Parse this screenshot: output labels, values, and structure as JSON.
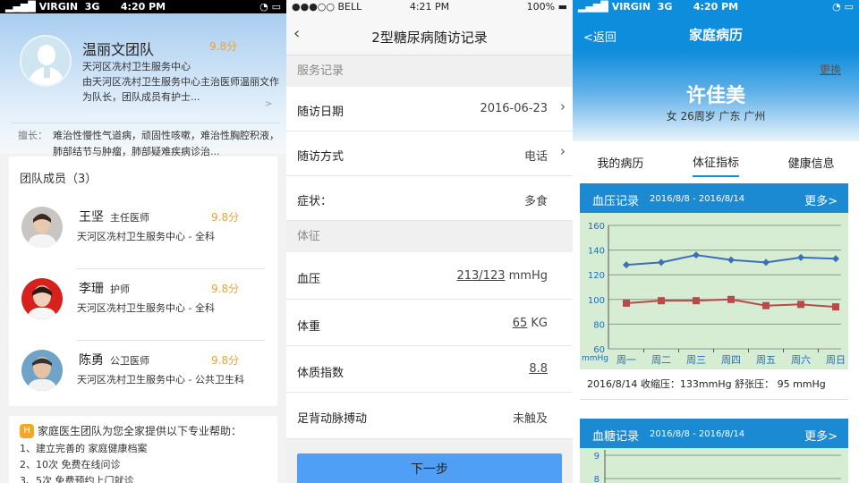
{
  "colors": {
    "accent": "#0d8ddb",
    "score": "#f0a034",
    "button": "#4f9ff7",
    "systolic": "#3b6fb8",
    "diastolic": "#b94a48",
    "chart_bg": "#d6ecd3"
  },
  "screen1": {
    "status": {
      "carrier": "VIRGIN",
      "network": "3G",
      "time": "4:20 PM"
    },
    "team_name": "温丽文团队",
    "score": "9.8分",
    "org": "天河区冼村卫生服务中心",
    "description": "由天河区冼村卫生服务中心主治医师温丽文作为队长，团队成员有护士...",
    "specialty_label": "擅长：",
    "specialty": "难治性慢性气道病，顽固性咳嗽，难治性胸腔积液，肺部结节与肿瘤，肺部疑难疾病诊治...",
    "members_title": "团队成员（3）",
    "members": [
      {
        "name": "王坚",
        "title": "主任医师",
        "score": "9.8分",
        "org": "天河区冼村卫生服务中心 - 全科"
      },
      {
        "name": "李珊",
        "title": "护师",
        "score": "9.8分",
        "org": "天河区冼村卫生服务中心 - 全科"
      },
      {
        "name": "陈勇",
        "title": "公卫医师",
        "score": "9.8分",
        "org": "天河区冼村卫生服务中心 - 公共卫生科"
      }
    ],
    "help_title": "家庭医生团队为您全家提供以下专业帮助：",
    "help_badge": "H",
    "help_items": [
      "1、建立完善的 家庭健康档案",
      "2、10次 免费在线问诊",
      "3、5次 免费预约上门就诊"
    ]
  },
  "screen2": {
    "status": {
      "carrier": "●●●○○ BELL",
      "time": "4:21 PM",
      "battery": "100%"
    },
    "back": "‹",
    "title": "2型糖尿病随访记录",
    "section1": "服务记录",
    "rows1": [
      {
        "key": "随访日期",
        "value": "2016-06-23",
        "arrow": true
      },
      {
        "key": "随访方式",
        "value": "电话",
        "arrow": true
      },
      {
        "key": "症状：",
        "value": "多食",
        "arrow": false
      }
    ],
    "section2": "体征",
    "vitals": {
      "bp_label": "血压",
      "bp_value": "213/123",
      "bp_unit": "mmHg",
      "weight_label": "体重",
      "weight_value": "65",
      "weight_unit": "KG",
      "bmi_label": "体质指数",
      "bmi_value": "8.8",
      "pulse_label": "足背动脉搏动",
      "pulse_value": "未触及"
    },
    "next_button": "下一步"
  },
  "screen3": {
    "status": {
      "carrier": "VIRGIN",
      "network": "3G",
      "time": "4:20 PM"
    },
    "back": "<返回",
    "title": "家庭病历",
    "change": "更换",
    "patient_name": "许佳美",
    "patient_info": "女  26周岁  广东 广州",
    "tabs": [
      "我的病历",
      "体征指标",
      "健康信息"
    ],
    "active_tab": 1,
    "bp_card": {
      "title": "血压记录",
      "dates": "2016/8/8 - 2016/8/14",
      "more": "更多>"
    },
    "bp_note": "2016/8/14 收缩压：133mmHg  舒张压： 95 mmHg",
    "sugar_card": {
      "title": "血糖记录",
      "dates": "2016/8/8 - 2016/8/14",
      "more": "更多>"
    }
  },
  "chart_data": [
    {
      "type": "line",
      "title": "血压记录",
      "ylabel": "mmHg",
      "categories": [
        "周一",
        "周二",
        "周三",
        "周四",
        "周五",
        "周六",
        "周日"
      ],
      "series": [
        {
          "values": [
            128,
            130,
            136,
            132,
            130,
            134,
            133
          ]
        },
        {
          "values": [
            97,
            99,
            99,
            100,
            95,
            96,
            94
          ]
        }
      ],
      "ylim": [
        60,
        160
      ],
      "yticks": [
        60,
        80,
        100,
        120,
        140,
        160
      ],
      "grid": true
    },
    {
      "type": "line",
      "title": "血糖记录",
      "ylim": [
        8,
        9
      ],
      "yticks": [
        8,
        9
      ],
      "grid": true
    }
  ]
}
